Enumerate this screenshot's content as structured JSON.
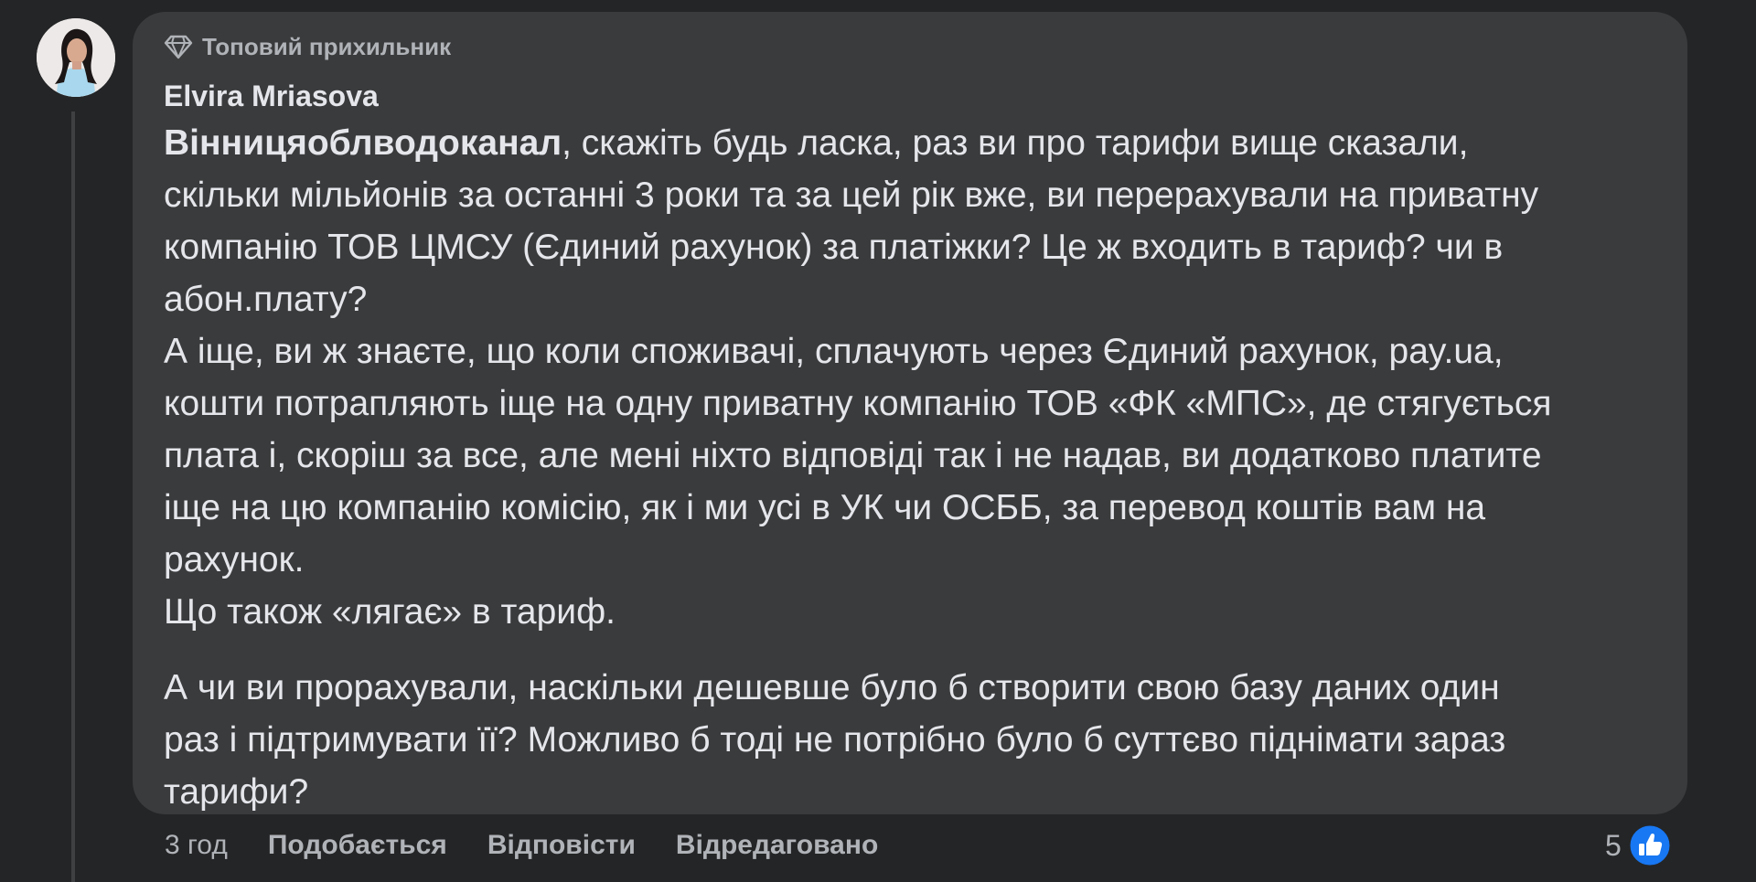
{
  "comment": {
    "badge": "Топовий прихильник",
    "author": "Elvira Mriasova",
    "mention": "Вінницяоблводоканал",
    "lines": [
      ", скажіть будь ласка, раз ви про тарифи вище сказали,",
      "скільки мільйонів за останні 3 роки та за цей рік вже, ви перерахували на приватну",
      "компанію ТОВ ЦМСУ (Єдиний рахунок) за платіжки? Це ж входить в тариф? чи в",
      "абон.плату?",
      "А іще, ви ж знаєте, що коли споживачі, сплачують через Єдиний рахунок, pay.ua,",
      "кошти потрапляють іще на одну приватну компанію ТОВ «ФК «МПС», де стягується",
      "плата і, скоріш за все, але мені ніхто відповіді так і не надав, ви додатково платите",
      "іще на цю компанію комісію, як і ми усі в УК чи ОСББ, за перевод коштів вам на",
      "рахунок.",
      "Що також «лягає» в тариф."
    ],
    "lines2": [
      "А чи ви прорахували, наскільки дешевше було б створити свою базу даних один",
      "раз і підтримувати її? Можливо б тоді не потрібно було б суттєво піднімати зараз",
      "тарифи?"
    ]
  },
  "actions": {
    "time": "3 год",
    "like": "Подобається",
    "reply": "Відповісти",
    "edited": "Відредаговано"
  },
  "reactions": {
    "count": "5",
    "icon": "like-icon",
    "color": "#1877f2"
  },
  "icons": {
    "badge": "diamond-icon"
  }
}
